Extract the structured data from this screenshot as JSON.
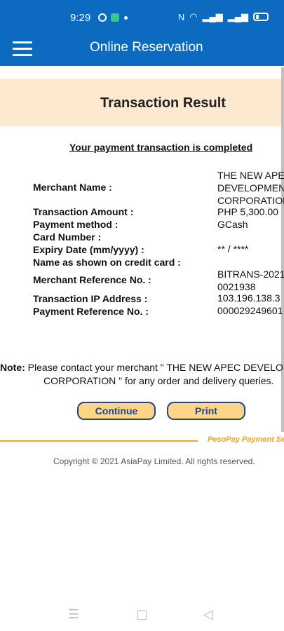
{
  "status_bar": {
    "time": "9:29",
    "icons": [
      "messenger-icon",
      "app-icon",
      "nfc-icon",
      "wifi-icon",
      "signal-icon",
      "signal-icon",
      "battery-icon"
    ],
    "accent_color": "#0c6bc1"
  },
  "app_bar": {
    "title": "Online Reservation",
    "menu_icon": "hamburger-icon"
  },
  "page": {
    "title": "Transaction Result",
    "status_message": "Your payment transaction is completed",
    "fields": [
      {
        "label": "Merchant Name :",
        "value_lines": [
          "THE NEW APEC",
          "DEVELOPMEN",
          "CORPORATION"
        ]
      },
      {
        "label": "Transaction Amount :",
        "value_lines": [
          "PHP 5,300.00"
        ]
      },
      {
        "label": "Payment method :",
        "value_lines": [
          "GCash"
        ]
      },
      {
        "label": "Card Number :",
        "value_lines": []
      },
      {
        "label": "Expiry Date (mm/yyyy) :",
        "value_lines": [
          "** / ****"
        ]
      },
      {
        "label": "Name as shown on credit card :",
        "value_lines": []
      },
      {
        "label": "Merchant Reference No. :",
        "value_lines": [
          "BITRANS-2021",
          "0021938"
        ]
      },
      {
        "label": "Transaction IP Address :",
        "value_lines": [
          "103.196.138.3"
        ]
      },
      {
        "label": "Payment Reference No. :",
        "value_lines": [
          "000029249601"
        ]
      }
    ],
    "note_label": "Note:",
    "note_line1": " Please contact your merchant \" THE NEW APEC DEVELO",
    "note_line2": "CORPORATION \" for any order and delivery queries.",
    "buttons": {
      "continue": "Continue",
      "print": "Print"
    },
    "powered_by": "PesoPay Payment Se",
    "copyright": "Copyright © 2021 AsiaPay Limited. All rights reserved."
  },
  "nav_bar": {
    "icons": [
      "menu-nav-icon",
      "home-nav-icon",
      "back-nav-icon"
    ]
  }
}
